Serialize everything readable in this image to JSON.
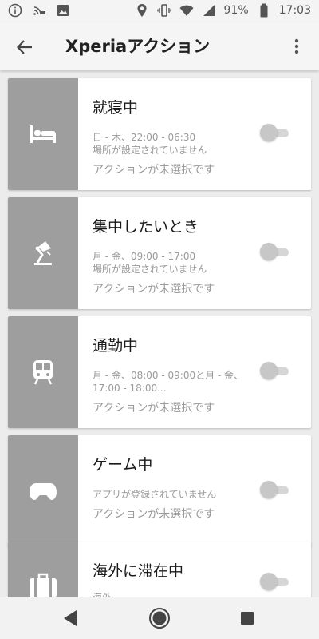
{
  "status_bar": {
    "icons": [
      "info-icon",
      "volte-icon",
      "image-icon",
      "location-icon",
      "vibrate-icon",
      "wifi-icon",
      "signal-icon",
      "battery-icon"
    ],
    "battery": "91%",
    "time": "17:03"
  },
  "app_bar": {
    "title": "Xperiaアクション"
  },
  "cards": [
    {
      "icon": "bed-icon",
      "title": "就寝中",
      "detail": "日 - 木、22:00 - 06:30\n場所が設定されていません",
      "action": "アクションが未選択です",
      "enabled": false
    },
    {
      "icon": "desk-lamp-icon",
      "title": "集中したいとき",
      "detail": "月 - 金、09:00 - 17:00\n場所が設定されていません",
      "action": "アクションが未選択です",
      "enabled": false
    },
    {
      "icon": "train-icon",
      "title": "通勤中",
      "detail": "月 - 金、08:00 - 09:00と月 - 金、17:00 - 18:00...",
      "action": "アクションが未選択です",
      "enabled": false
    },
    {
      "icon": "gamepad-icon",
      "title": "ゲーム中",
      "detail": "アプリが登録されていません",
      "action": "アクションが未選択です",
      "enabled": false
    },
    {
      "icon": "suitcase-icon",
      "title": "海外に滞在中",
      "detail": "海外",
      "action": "",
      "enabled": false
    }
  ],
  "colors": {
    "icon_box": "#9e9e9e",
    "background": "#ececec",
    "text_primary": "#1a1a1a",
    "text_secondary": "#9a9a9a"
  },
  "nav_bar": {
    "icons": [
      "back-triangle-icon",
      "home-circle-icon",
      "recents-square-icon"
    ]
  }
}
